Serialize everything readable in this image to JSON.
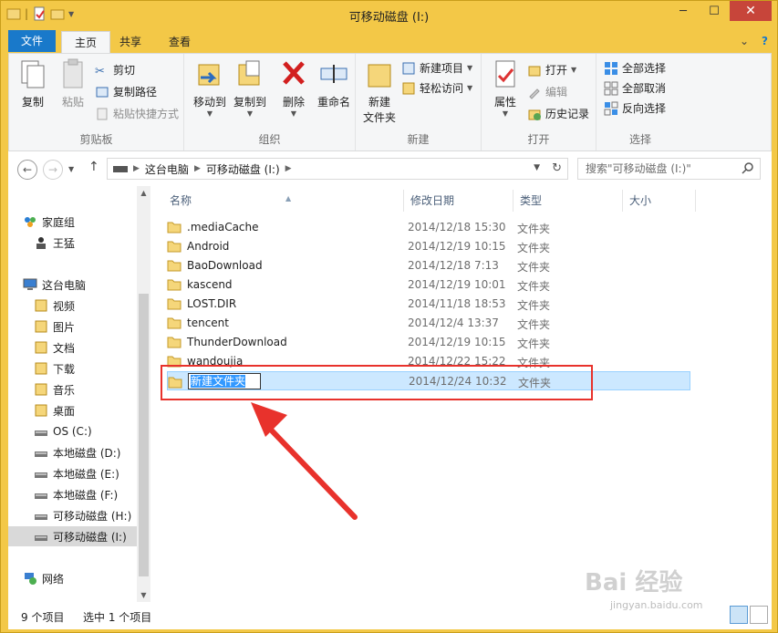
{
  "window": {
    "title": "可移动磁盘 (I:)",
    "minimize": "─",
    "maximize": "☐",
    "close": "✕"
  },
  "tabs": {
    "file": "文件",
    "home": "主页",
    "share": "共享",
    "view": "查看",
    "expand": "⌄",
    "help": "?"
  },
  "ribbon": {
    "clipboard": {
      "label": "剪贴板",
      "copy": "复制",
      "paste": "粘贴",
      "cut": "剪切",
      "copy_path": "复制路径",
      "paste_shortcut": "粘贴快捷方式"
    },
    "organize": {
      "label": "组织",
      "move_to": "移动到",
      "copy_to": "复制到",
      "delete": "删除",
      "rename": "重命名"
    },
    "new": {
      "label": "新建",
      "new_folder": "新建\n文件夹",
      "new_folder_l1": "新建",
      "new_folder_l2": "文件夹",
      "new_item": "新建项目",
      "easy_access": "轻松访问"
    },
    "open": {
      "label": "打开",
      "properties": "属性",
      "open": "打开",
      "edit": "编辑",
      "history": "历史记录"
    },
    "select": {
      "label": "选择",
      "select_all": "全部选择",
      "select_none": "全部取消",
      "invert": "反向选择"
    }
  },
  "address": {
    "crumbs": [
      "这台电脑",
      "可移动磁盘 (I:)"
    ],
    "search_placeholder": "搜索\"可移动磁盘 (I:)\""
  },
  "nav": {
    "items": [
      {
        "label": "家庭组",
        "icon": "homegroup-icon"
      },
      {
        "label": "王猛",
        "icon": "user-icon"
      },
      {
        "label": "这台电脑",
        "icon": "computer-icon"
      },
      {
        "label": "视频",
        "icon": "videos-icon"
      },
      {
        "label": "图片",
        "icon": "pictures-icon"
      },
      {
        "label": "文档",
        "icon": "documents-icon"
      },
      {
        "label": "下载",
        "icon": "downloads-icon"
      },
      {
        "label": "音乐",
        "icon": "music-icon"
      },
      {
        "label": "桌面",
        "icon": "desktop-icon"
      },
      {
        "label": "OS (C:)",
        "icon": "windows-drive-icon"
      },
      {
        "label": "本地磁盘 (D:)",
        "icon": "drive-icon"
      },
      {
        "label": "本地磁盘 (E:)",
        "icon": "drive-icon"
      },
      {
        "label": "本地磁盘 (F:)",
        "icon": "drive-icon"
      },
      {
        "label": "可移动磁盘 (H:)",
        "icon": "removable-drive-icon"
      },
      {
        "label": "可移动磁盘 (I:)",
        "icon": "removable-drive-icon"
      },
      {
        "label": "网络",
        "icon": "network-icon"
      }
    ]
  },
  "columns": {
    "name": "名称",
    "modified": "修改日期",
    "type": "类型",
    "size": "大小"
  },
  "files": [
    {
      "name": ".mediaCache",
      "date": "2014/12/18 15:30",
      "type": "文件夹"
    },
    {
      "name": "Android",
      "date": "2014/12/19 10:15",
      "type": "文件夹"
    },
    {
      "name": "BaoDownload",
      "date": "2014/12/18 7:13",
      "type": "文件夹"
    },
    {
      "name": "kascend",
      "date": "2014/12/19 10:01",
      "type": "文件夹"
    },
    {
      "name": "LOST.DIR",
      "date": "2014/11/18 18:53",
      "type": "文件夹"
    },
    {
      "name": "tencent",
      "date": "2014/12/4 13:37",
      "type": "文件夹"
    },
    {
      "name": "ThunderDownload",
      "date": "2014/12/19 10:15",
      "type": "文件夹"
    },
    {
      "name": "wandoujia",
      "date": "2014/12/22 15:22",
      "type": "文件夹"
    }
  ],
  "new_folder_row": {
    "name": "新建文件夹",
    "date": "2014/12/24 10:32",
    "type": "文件夹"
  },
  "status": {
    "count": "9 个项目",
    "selected": "选中 1 个项目"
  },
  "watermark": {
    "brand": "Bai 经验",
    "url": "jingyan.baidu.com"
  },
  "colors": {
    "title_bar": "#f3c847",
    "file_tab": "#1979ca",
    "selection": "#cce8ff",
    "annotation": "#e8322c"
  }
}
